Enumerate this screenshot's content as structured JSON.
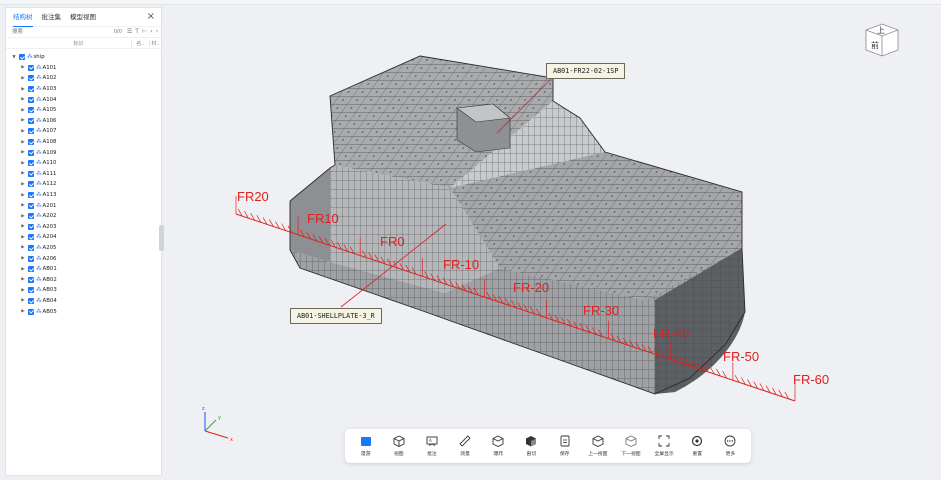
{
  "panel": {
    "tabs": [
      {
        "label": "结构树",
        "active": true
      },
      {
        "label": "批注集",
        "active": false
      },
      {
        "label": "模型视图",
        "active": false
      }
    ],
    "close_icon": "close-icon",
    "search_placeholder": "搜索",
    "search_count": "0/0",
    "columns": [
      "标识",
      "名..",
      "材.."
    ],
    "root": "ship",
    "nodes": [
      "A101",
      "A102",
      "A103",
      "A104",
      "A105",
      "A106",
      "A107",
      "A108",
      "A109",
      "A110",
      "A111",
      "A112",
      "A113",
      "A201",
      "A202",
      "A203",
      "A204",
      "A205",
      "A206",
      "AB01",
      "AB02",
      "AB03",
      "AB04",
      "AB05"
    ]
  },
  "viewcube": {
    "top": "上",
    "front": "前"
  },
  "frame_labels": [
    "FR20",
    "FR10",
    "FR0",
    "FR-10",
    "FR-20",
    "FR-30",
    "FR-40",
    "FR-50",
    "FR-60"
  ],
  "callouts": {
    "top": "AB01-FR22-02-1SP",
    "bottom": "AB01-SHELLPLATE-3_R"
  },
  "axes": {
    "x": "x",
    "y": "y",
    "z": "z"
  },
  "toolbar": [
    {
      "label": "漫游",
      "icon": "walk-icon"
    },
    {
      "label": "视图",
      "icon": "view-cube-icon"
    },
    {
      "label": "批注",
      "icon": "annotation-icon"
    },
    {
      "label": "测量",
      "icon": "ruler-icon"
    },
    {
      "label": "爆炸",
      "icon": "explode-icon"
    },
    {
      "label": "剖切",
      "icon": "section-icon"
    },
    {
      "label": "保存",
      "icon": "save-icon"
    },
    {
      "label": "上一视图",
      "icon": "prev-view-icon"
    },
    {
      "label": "下一视图",
      "icon": "next-view-icon"
    },
    {
      "label": "全屏显示",
      "icon": "fullscreen-icon"
    },
    {
      "label": "重置",
      "icon": "reset-icon"
    },
    {
      "label": "更多",
      "icon": "more-icon"
    }
  ],
  "colors": {
    "accent": "#1677ff",
    "frame_line": "#e02020",
    "hull": "#b9bbbe"
  }
}
